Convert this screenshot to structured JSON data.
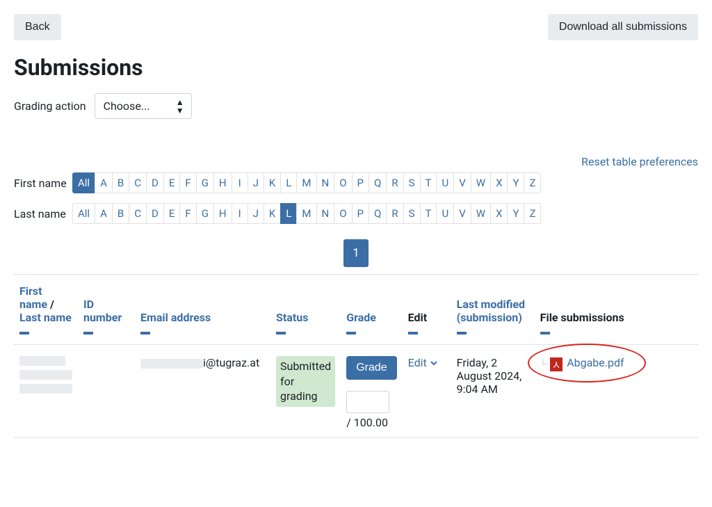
{
  "top": {
    "back": "Back",
    "download": "Download all submissions"
  },
  "title": "Submissions",
  "grading": {
    "label": "Grading action",
    "select": "Choose..."
  },
  "reset_link": "Reset table preferences",
  "filters": {
    "first_label": "First name",
    "last_label": "Last name",
    "first_active": "All",
    "last_active": "L",
    "letters": [
      "All",
      "A",
      "B",
      "C",
      "D",
      "E",
      "F",
      "G",
      "H",
      "I",
      "J",
      "K",
      "L",
      "M",
      "N",
      "O",
      "P",
      "Q",
      "R",
      "S",
      "T",
      "U",
      "V",
      "W",
      "X",
      "Y",
      "Z"
    ]
  },
  "pagination": {
    "current": "1"
  },
  "columns": {
    "first": "First name",
    "last": "Last name",
    "id": "ID number",
    "email": "Email address",
    "status": "Status",
    "grade": "Grade",
    "edit": "Edit",
    "modified": "Last modified (submission)",
    "file": "File submissions"
  },
  "row": {
    "email_suffix": "i@tugraz.at",
    "status": "Submitted for grading",
    "grade_btn": "Grade",
    "grade_denominator": "/ 100.00",
    "edit": "Edit",
    "modified": "Friday, 2 August 2024, 9:04 AM",
    "file": "Abgabe.pdf",
    "pdf_letter": "人"
  }
}
